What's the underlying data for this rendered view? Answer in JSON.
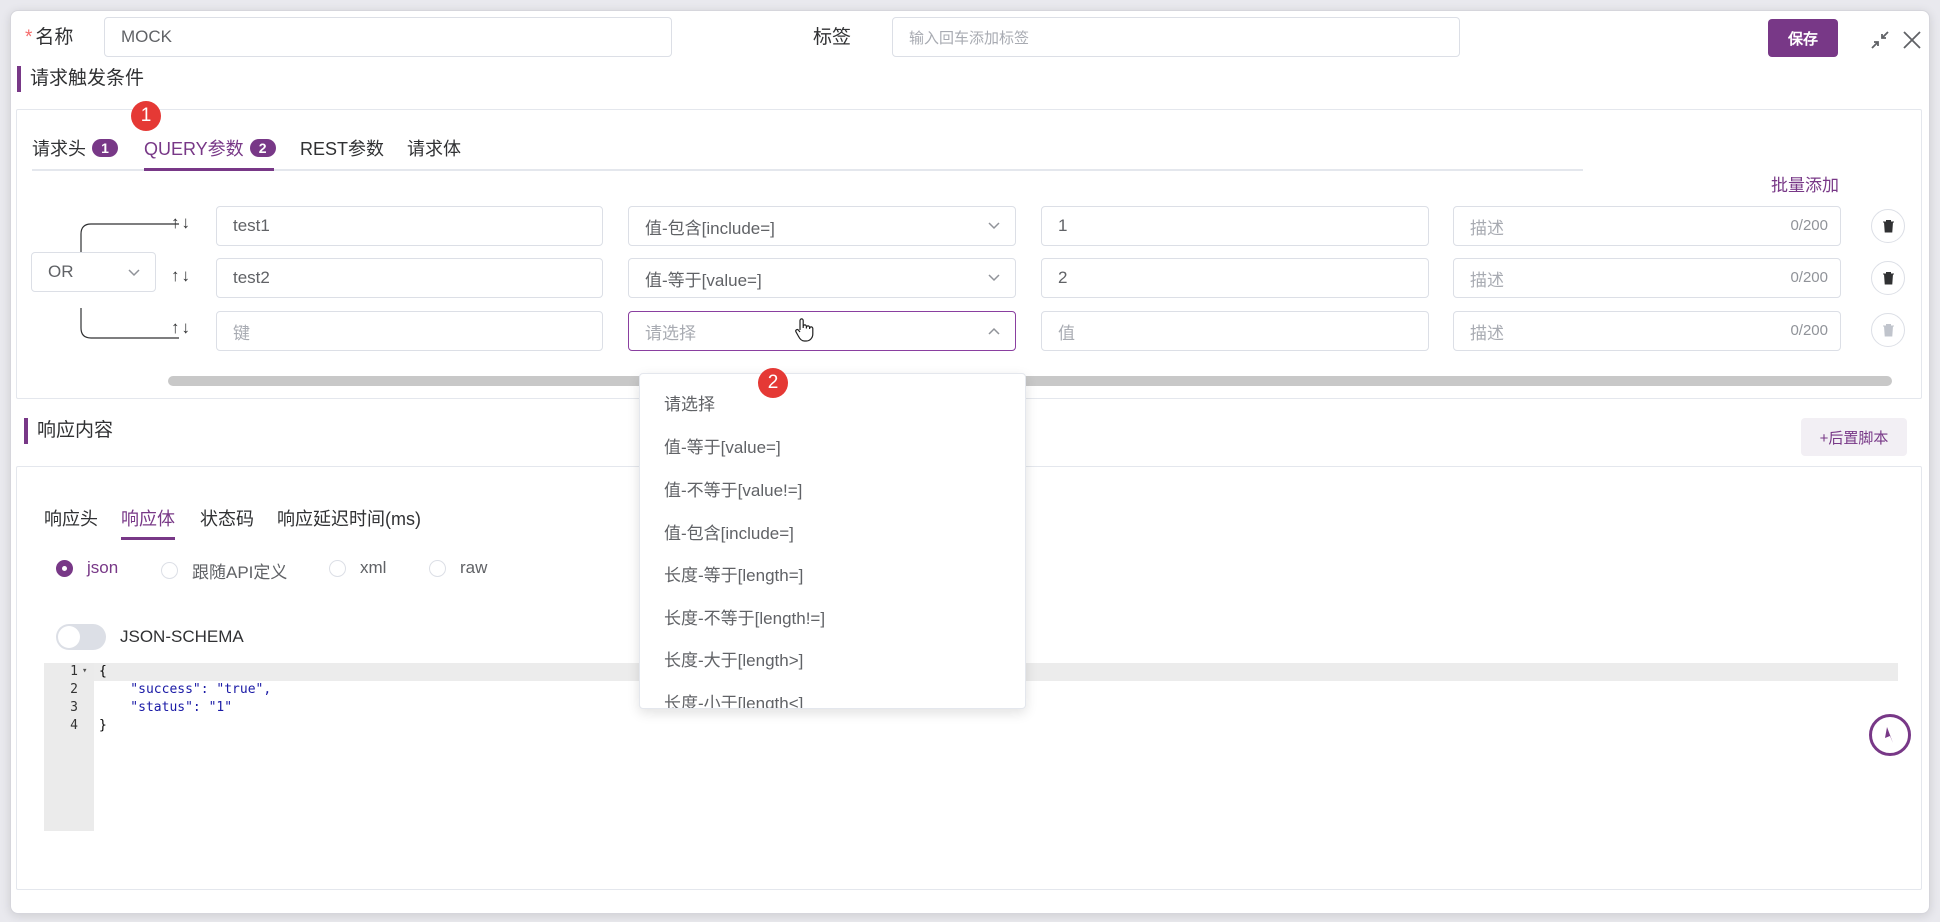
{
  "header": {
    "name_label": "名称",
    "required_mark": "*",
    "name_value": "MOCK",
    "tags_label": "标签",
    "tags_placeholder": "输入回车添加标签",
    "save_label": "保存"
  },
  "request": {
    "section_title": "请求触发条件",
    "tabs": [
      {
        "label": "请求头",
        "badge": "1"
      },
      {
        "label": "QUERY参数",
        "badge": "2"
      },
      {
        "label": "REST参数"
      },
      {
        "label": "请求体"
      }
    ],
    "step_marker": "1",
    "batch_add_label": "批量添加",
    "logic_operator": "OR",
    "rows": [
      {
        "key": "test1",
        "condition": "值-包含[include=]",
        "value": "1",
        "desc_placeholder": "描述",
        "counter": "0/200"
      },
      {
        "key": "test2",
        "condition": "值-等于[value=]",
        "value": "2",
        "desc_placeholder": "描述",
        "counter": "0/200"
      },
      {
        "key_placeholder": "键",
        "condition_placeholder": "请选择",
        "value_placeholder": "值",
        "desc_placeholder": "描述",
        "counter": "0/200"
      }
    ],
    "dropdown": {
      "step_marker": "2",
      "options": [
        "请选择",
        "值-等于[value=]",
        "值-不等于[value!=]",
        "值-包含[include=]",
        "长度-等于[length=]",
        "长度-不等于[length!=]",
        "长度-大于[length>]",
        "长度-小于[length<]"
      ]
    }
  },
  "response": {
    "section_title": "响应内容",
    "post_script_label": "+后置脚本",
    "tabs": [
      "响应头",
      "响应体",
      "状态码",
      "响应延迟时间(ms)"
    ],
    "body_types": [
      "json",
      "跟随API定义",
      "xml",
      "raw"
    ],
    "selected_body_type": "json",
    "schema_label": "JSON-SCHEMA",
    "code": {
      "line_numbers": [
        "1",
        "2",
        "3",
        "4"
      ],
      "lines": [
        "{",
        "    \"success\": \"true\",",
        "    \"status\": \"1\"",
        "}"
      ]
    }
  },
  "colors": {
    "accent": "#783887",
    "marker": "#e53935"
  }
}
